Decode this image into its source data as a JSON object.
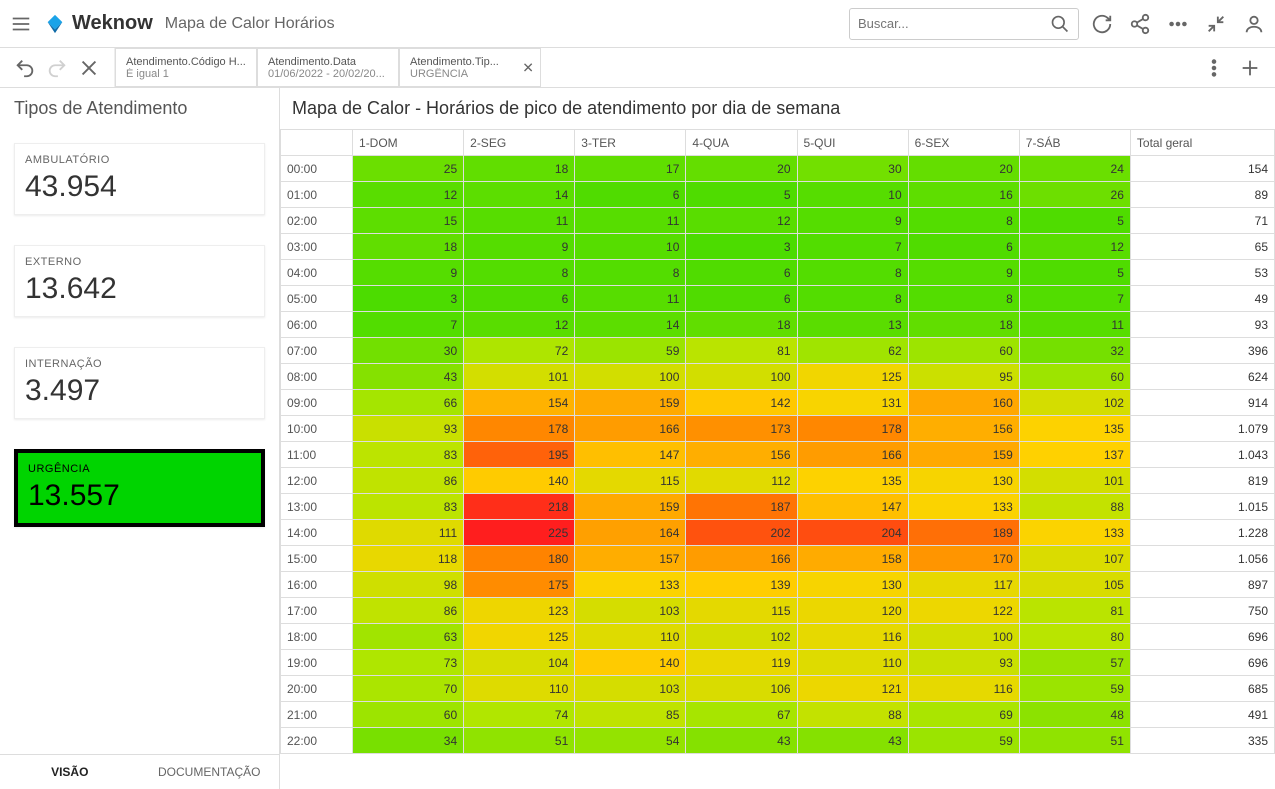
{
  "header": {
    "logo_text": "Weknow",
    "title": "Mapa de Calor Horários",
    "search_placeholder": "Buscar..."
  },
  "filters": [
    {
      "line1": "Atendimento.Código H...",
      "line2": "É igual 1"
    },
    {
      "line1": "Atendimento.Data",
      "line2": "01/06/2022 - 20/02/20..."
    },
    {
      "line1": "Atendimento.Tip...",
      "line2": "URGÊNCIA",
      "close": true
    }
  ],
  "sidebar": {
    "title": "Tipos de Atendimento",
    "cards": [
      {
        "label": "AMBULATÓRIO",
        "value": "43.954",
        "selected": false
      },
      {
        "label": "EXTERNO",
        "value": "13.642",
        "selected": false
      },
      {
        "label": "INTERNAÇÃO",
        "value": "3.497",
        "selected": false
      },
      {
        "label": "URGÊNCIA",
        "value": "13.557",
        "selected": true
      }
    ],
    "tabs": {
      "visao": "VISÃO",
      "doc": "DOCUMENTAÇÃO"
    }
  },
  "chart_title": "Mapa de Calor - Horários de pico de atendimento por dia de semana",
  "chart_data": {
    "type": "heatmap",
    "title": "Mapa de Calor - Horários de pico de atendimento por dia de semana",
    "xlabel": "",
    "ylabel": "",
    "columns": [
      "1-DOM",
      "2-SEG",
      "3-TER",
      "4-QUA",
      "5-QUI",
      "6-SEX",
      "7-SÁB"
    ],
    "total_column": "Total geral",
    "rows": [
      {
        "hour": "00:00",
        "values": [
          25,
          18,
          17,
          20,
          30,
          20,
          24
        ],
        "total": 154
      },
      {
        "hour": "01:00",
        "values": [
          12,
          14,
          6,
          5,
          10,
          16,
          26
        ],
        "total": 89
      },
      {
        "hour": "02:00",
        "values": [
          15,
          11,
          11,
          12,
          9,
          8,
          5
        ],
        "total": 71
      },
      {
        "hour": "03:00",
        "values": [
          18,
          9,
          10,
          3,
          7,
          6,
          12
        ],
        "total": 65
      },
      {
        "hour": "04:00",
        "values": [
          9,
          8,
          8,
          6,
          8,
          9,
          5
        ],
        "total": 53
      },
      {
        "hour": "05:00",
        "values": [
          3,
          6,
          11,
          6,
          8,
          8,
          7
        ],
        "total": 49
      },
      {
        "hour": "06:00",
        "values": [
          7,
          12,
          14,
          18,
          13,
          18,
          11
        ],
        "total": 93
      },
      {
        "hour": "07:00",
        "values": [
          30,
          72,
          59,
          81,
          62,
          60,
          32
        ],
        "total": 396
      },
      {
        "hour": "08:00",
        "values": [
          43,
          101,
          100,
          100,
          125,
          95,
          60
        ],
        "total": 624
      },
      {
        "hour": "09:00",
        "values": [
          66,
          154,
          159,
          142,
          131,
          160,
          102
        ],
        "total": 914
      },
      {
        "hour": "10:00",
        "values": [
          93,
          178,
          166,
          173,
          178,
          156,
          135
        ],
        "total": "1.079"
      },
      {
        "hour": "11:00",
        "values": [
          83,
          195,
          147,
          156,
          166,
          159,
          137
        ],
        "total": "1.043"
      },
      {
        "hour": "12:00",
        "values": [
          86,
          140,
          115,
          112,
          135,
          130,
          101
        ],
        "total": 819
      },
      {
        "hour": "13:00",
        "values": [
          83,
          218,
          159,
          187,
          147,
          133,
          88
        ],
        "total": "1.015"
      },
      {
        "hour": "14:00",
        "values": [
          111,
          225,
          164,
          202,
          204,
          189,
          133
        ],
        "total": "1.228"
      },
      {
        "hour": "15:00",
        "values": [
          118,
          180,
          157,
          166,
          158,
          170,
          107
        ],
        "total": "1.056"
      },
      {
        "hour": "16:00",
        "values": [
          98,
          175,
          133,
          139,
          130,
          117,
          105
        ],
        "total": 897
      },
      {
        "hour": "17:00",
        "values": [
          86,
          123,
          103,
          115,
          120,
          122,
          81
        ],
        "total": 750
      },
      {
        "hour": "18:00",
        "values": [
          63,
          125,
          110,
          102,
          116,
          100,
          80
        ],
        "total": 696
      },
      {
        "hour": "19:00",
        "values": [
          73,
          104,
          140,
          119,
          110,
          93,
          57
        ],
        "total": 696
      },
      {
        "hour": "20:00",
        "values": [
          70,
          110,
          103,
          106,
          121,
          116,
          59
        ],
        "total": 685
      },
      {
        "hour": "21:00",
        "values": [
          60,
          74,
          85,
          67,
          88,
          69,
          48
        ],
        "total": 491
      },
      {
        "hour": "22:00",
        "values": [
          34,
          51,
          54,
          43,
          43,
          59,
          51
        ],
        "total": 335
      }
    ]
  }
}
